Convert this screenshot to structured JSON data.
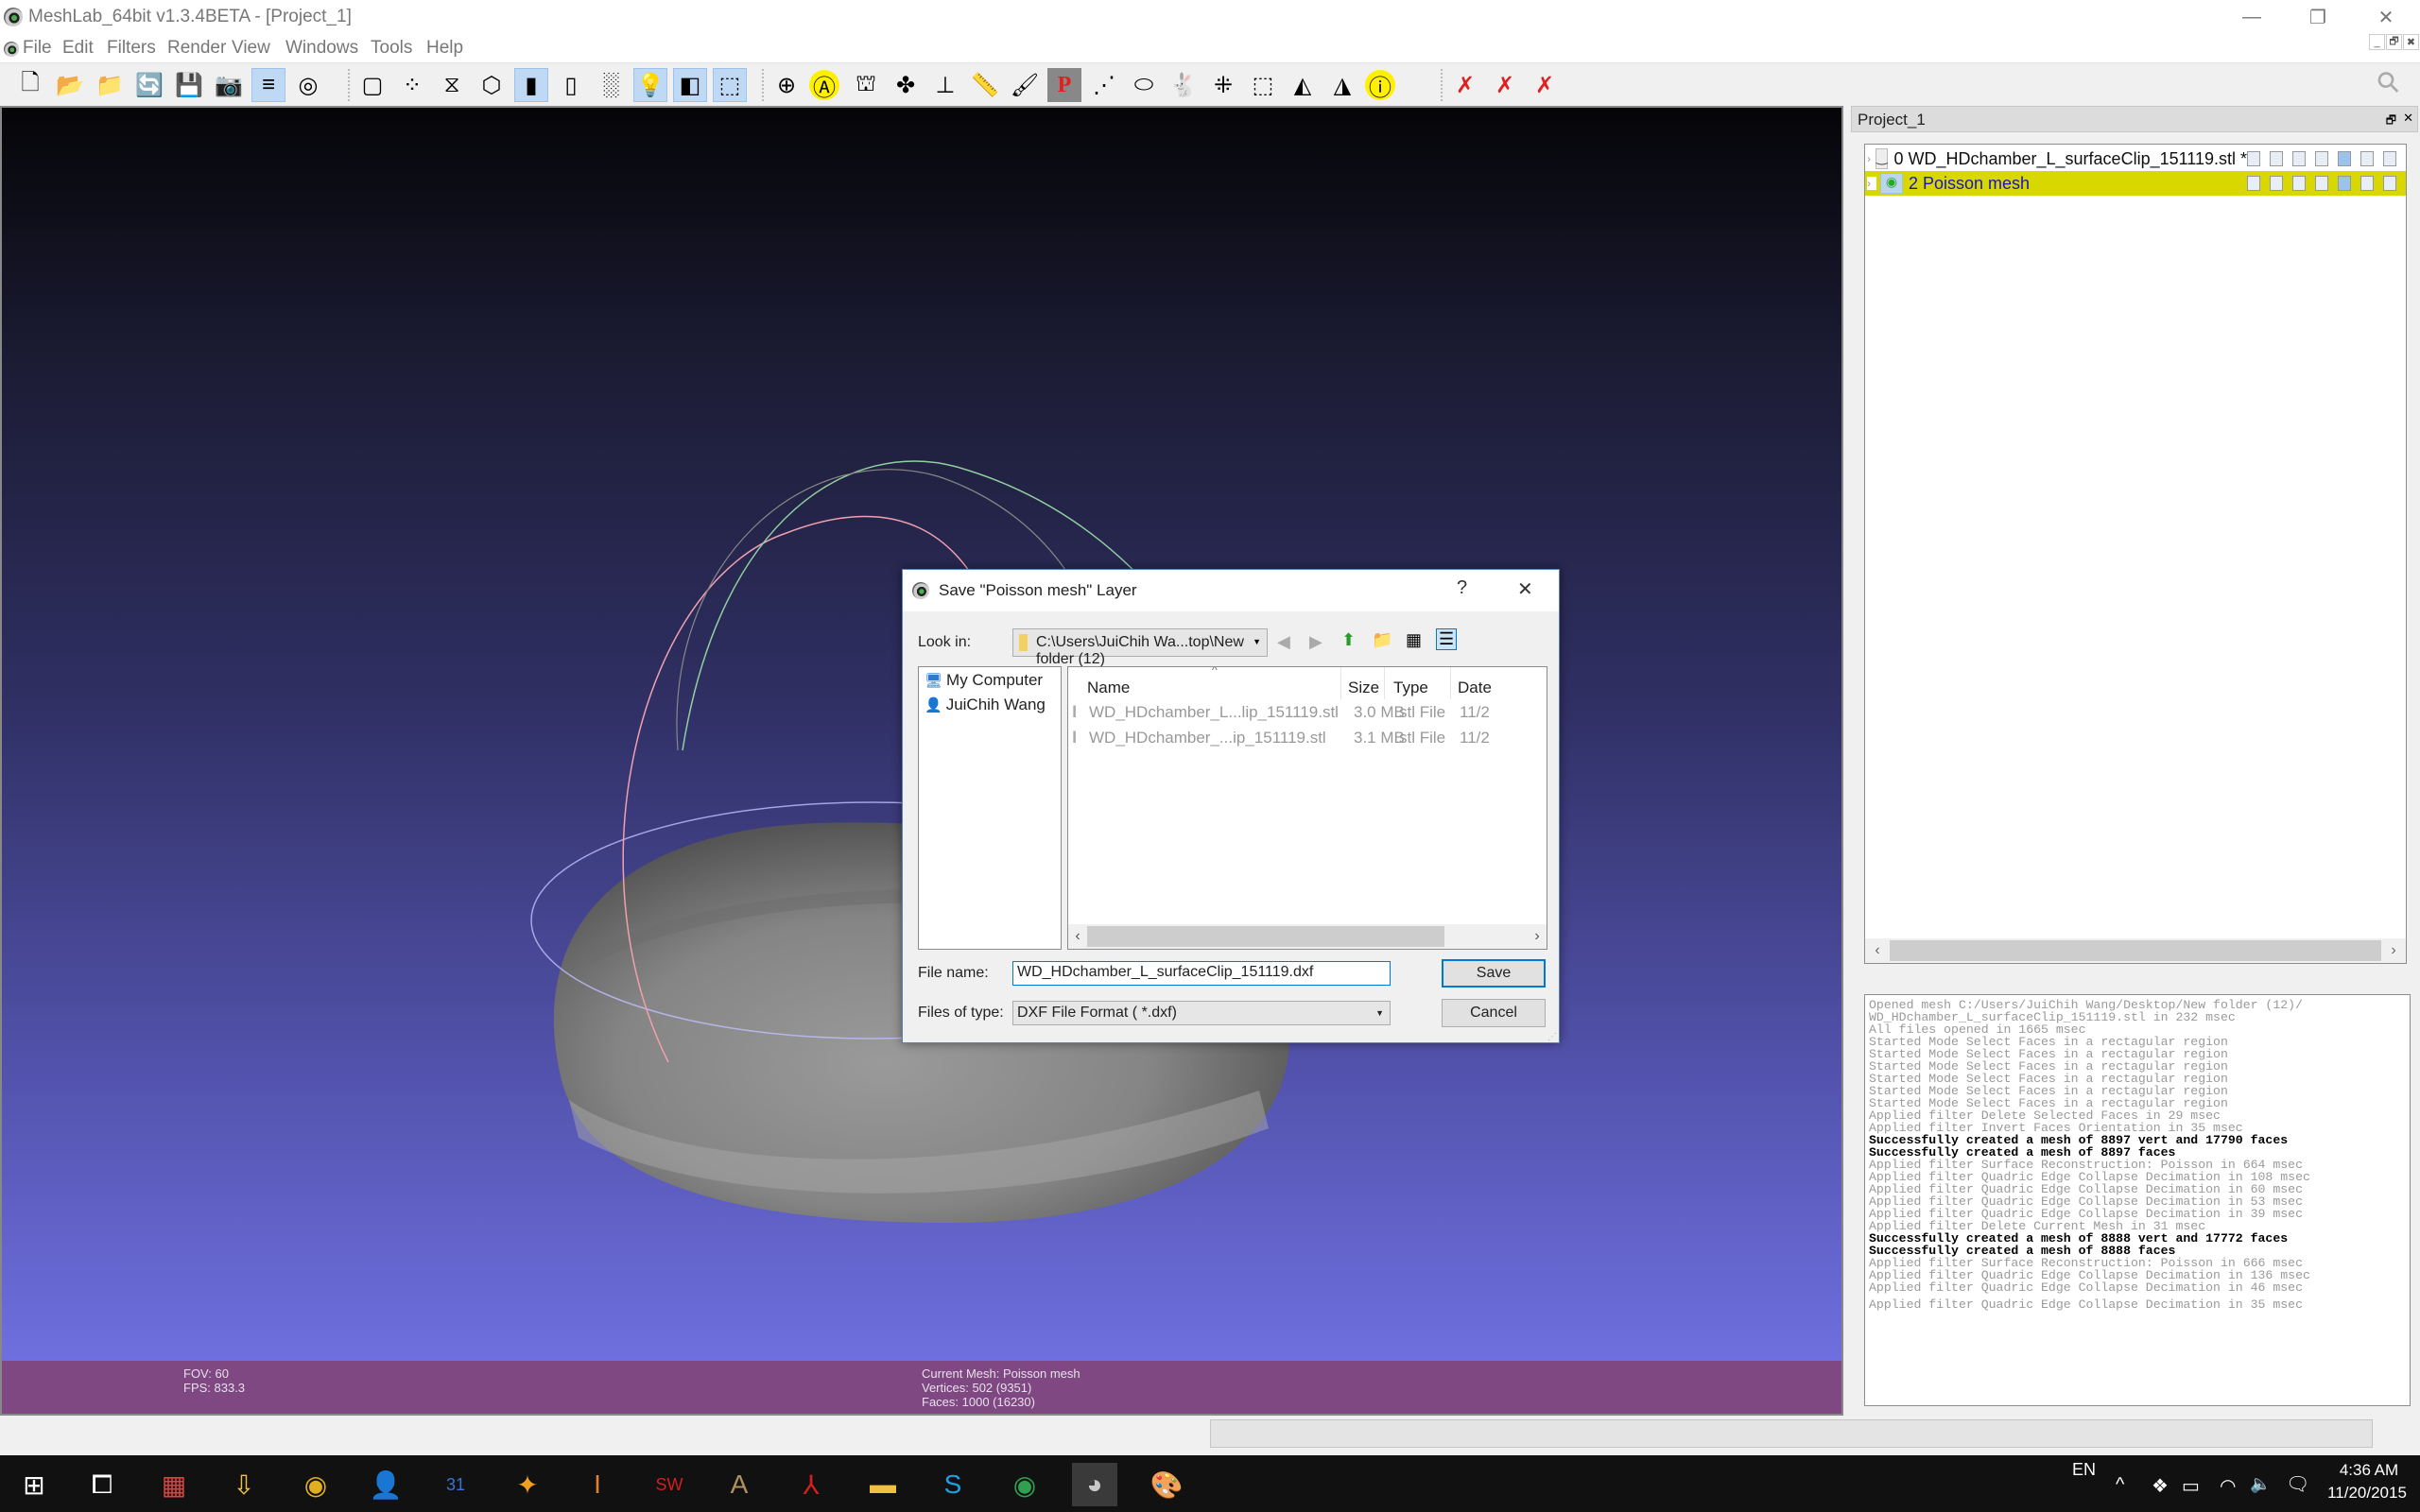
{
  "window": {
    "title": "MeshLab_64bit v1.3.4BETA - [Project_1]",
    "controls": {
      "minimize": "—",
      "restore": "❐",
      "close": "✕"
    },
    "mdi_controls": {
      "minimize": "_",
      "restore": "🗗",
      "close": "✖"
    }
  },
  "menu": [
    "File",
    "Edit",
    "Filters",
    "Render",
    "View",
    "Windows",
    "Tools",
    "Help"
  ],
  "toolbar": {
    "groups": [
      [
        {
          "name": "new-project-icon",
          "glyph": "🗋",
          "active": false
        },
        {
          "name": "open-mesh-icon",
          "glyph": "📂",
          "active": false
        },
        {
          "name": "reload-icon",
          "glyph": "📁",
          "active": false
        },
        {
          "name": "reload-all-icon",
          "glyph": "🔄",
          "active": false
        },
        {
          "name": "save-icon",
          "glyph": "💾",
          "active": false
        },
        {
          "name": "snapshot-icon",
          "glyph": "📷",
          "active": false
        },
        {
          "name": "layers-icon",
          "glyph": "≡",
          "active": true
        },
        {
          "name": "raster-icon",
          "glyph": "◎",
          "active": false
        }
      ],
      [
        {
          "name": "bbox-icon",
          "glyph": "▢",
          "active": false
        },
        {
          "name": "points-icon",
          "glyph": "⁘",
          "active": false
        },
        {
          "name": "wireframe-icon",
          "glyph": "⧖",
          "active": false
        },
        {
          "name": "flat-lines-icon",
          "glyph": "⬡",
          "active": false
        },
        {
          "name": "flat-icon",
          "glyph": "▮",
          "active": true
        },
        {
          "name": "smooth-icon",
          "glyph": "▯",
          "active": false
        },
        {
          "name": "texture-icon",
          "glyph": "░",
          "active": false
        },
        {
          "name": "light-icon",
          "glyph": "💡",
          "active": true
        },
        {
          "name": "backface-icon",
          "glyph": "◧",
          "active": true
        },
        {
          "name": "selected-vertices-icon",
          "glyph": "⬚",
          "active": true
        }
      ],
      [
        {
          "name": "trackball-icon",
          "glyph": "⊕",
          "active": false
        },
        {
          "name": "annotation-icon",
          "glyph": "Ⓐ",
          "active": false
        },
        {
          "name": "arc-icon",
          "glyph": "⛫",
          "active": false
        },
        {
          "name": "align-icon",
          "glyph": "✤",
          "active": false
        },
        {
          "name": "axis-icon",
          "glyph": "⊥",
          "active": false
        },
        {
          "name": "measure-icon",
          "glyph": "📏",
          "active": false
        },
        {
          "name": "paint-icon",
          "glyph": "🖌",
          "active": false
        },
        {
          "name": "pick-points-icon",
          "glyph": "P",
          "active": false
        },
        {
          "name": "select-connected-icon",
          "glyph": "⋰",
          "active": false
        },
        {
          "name": "select-vertices-icon",
          "glyph": "⬭",
          "active": false
        },
        {
          "name": "quality-map-icon",
          "glyph": "🐇",
          "active": false
        },
        {
          "name": "reference-icon",
          "glyph": "⁜",
          "active": false
        },
        {
          "name": "select-region-icon",
          "glyph": "⬚",
          "active": false
        },
        {
          "name": "select-faces-icon",
          "glyph": "◭",
          "active": false
        },
        {
          "name": "select-faces-add-icon",
          "glyph": "◮",
          "active": false
        },
        {
          "name": "info-icon",
          "glyph": "ⓘ",
          "active": false
        }
      ],
      [
        {
          "name": "delete-vertices-icon",
          "glyph": "✗",
          "active": false
        },
        {
          "name": "delete-faces-icon",
          "glyph": "✗",
          "active": false
        },
        {
          "name": "delete-faces-vertices-icon",
          "glyph": "✗",
          "active": false
        }
      ]
    ],
    "search_icon": "⚲"
  },
  "viewport": {
    "fov": "FOV: 60",
    "fps": "FPS:  833.3",
    "current_mesh": "Current Mesh: Poisson mesh",
    "vertices": "Vertices: 502 (9351)",
    "faces": "Faces: 1000 (16230)"
  },
  "layer_panel": {
    "title": "Project_1",
    "float_icon": "🗗",
    "close_icon": "✕",
    "layers": [
      {
        "label": "0 WD_HDchamber_L_surfaceClip_151119.stl *",
        "selected": false,
        "visible": false
      },
      {
        "label": "2 Poisson mesh",
        "selected": true,
        "visible": true
      }
    ]
  },
  "log": [
    {
      "text": "Opened mesh C:/Users/JuiChih Wang/Desktop/New folder (12)/",
      "bold": false
    },
    {
      "text": "WD_HDchamber_L_surfaceClip_151119.stl in 232 msec",
      "bold": false
    },
    {
      "text": "All files opened in 1665 msec",
      "bold": false
    },
    {
      "text": "Started Mode Select Faces in a rectagular region",
      "bold": false
    },
    {
      "text": "Started Mode Select Faces in a rectagular region",
      "bold": false
    },
    {
      "text": "Started Mode Select Faces in a rectagular region",
      "bold": false
    },
    {
      "text": "Started Mode Select Faces in a rectagular region",
      "bold": false
    },
    {
      "text": "Started Mode Select Faces in a rectagular region",
      "bold": false
    },
    {
      "text": "Started Mode Select Faces in a rectagular region",
      "bold": false
    },
    {
      "text": "Applied filter Delete Selected Faces in 29 msec",
      "bold": false
    },
    {
      "text": "Applied filter Invert Faces Orientation in 35 msec",
      "bold": false
    },
    {
      "text": "Successfully created a mesh of 8897 vert and 17790 faces",
      "bold": true
    },
    {
      "text": "Successfully created a mesh of 8897 faces",
      "bold": true
    },
    {
      "text": "Applied filter Surface Reconstruction: Poisson in 664 msec",
      "bold": false
    },
    {
      "text": "Applied filter Quadric Edge Collapse Decimation in 108 msec",
      "bold": false
    },
    {
      "text": "Applied filter Quadric Edge Collapse Decimation in 60 msec",
      "bold": false
    },
    {
      "text": "Applied filter Quadric Edge Collapse Decimation in 53 msec",
      "bold": false
    },
    {
      "text": "Applied filter Quadric Edge Collapse Decimation in 39 msec",
      "bold": false
    },
    {
      "text": "Applied filter Delete Current Mesh in 31 msec",
      "bold": false
    },
    {
      "text": "Successfully created a mesh of 8888 vert and 17772 faces",
      "bold": true
    },
    {
      "text": "Successfully created a mesh of 8888 faces",
      "bold": true
    },
    {
      "text": "Applied filter Surface Reconstruction: Poisson in 666 msec",
      "bold": false
    },
    {
      "text": "Applied filter Quadric Edge Collapse Decimation in 136 msec",
      "bold": false
    },
    {
      "text": "Applied filter Quadric Edge Collapse Decimation in 46 msec",
      "bold": false
    },
    {
      "text": "",
      "bold": false
    },
    {
      "text": "Applied filter Quadric Edge Collapse Decimation in 35 msec",
      "bold": false
    }
  ],
  "dialog": {
    "title": "Save \"Poisson mesh\" Layer",
    "help": "?",
    "close": "✕",
    "look_in_label": "Look in:",
    "look_in_value": "C:\\Users\\JuiChih Wa...top\\New folder (12)",
    "nav": {
      "back": "◀",
      "forward": "▶",
      "up": "⬆",
      "new_folder": "📁",
      "list_view": "▦",
      "detail_view": "☰"
    },
    "places": [
      {
        "label": "My Computer",
        "icon": "computer-icon"
      },
      {
        "label": "JuiChih Wang",
        "icon": "user-folder-icon"
      }
    ],
    "columns": [
      "Name",
      "Size",
      "Type",
      "Date"
    ],
    "sort_indicator": "^",
    "files": [
      {
        "name": "WD_HDchamber_L...lip_151119.stl",
        "size": "3.0 MB",
        "type": "stl File",
        "date": "11/2"
      },
      {
        "name": "WD_HDchamber_...ip_151119.stl",
        "size": "3.1 MB",
        "type": "stl File",
        "date": "11/2"
      }
    ],
    "file_name_label": "File name:",
    "file_name_value": "WD_HDchamber_L_surfaceClip_151119.dxf",
    "file_type_label": "Files of type:",
    "file_type_value": "DXF File Format ( *.dxf)",
    "save_label": "Save",
    "cancel_label": "Cancel"
  },
  "taskbar": {
    "apps": [
      {
        "name": "start-icon",
        "glyph": "⊞",
        "color": "#ffffff"
      },
      {
        "name": "task-view-icon",
        "glyph": "⧠",
        "color": "#ffffff"
      },
      {
        "name": "store-icon",
        "glyph": "▦",
        "color": "#e04040"
      },
      {
        "name": "downloads-icon",
        "glyph": "⇩",
        "color": "#f0c040"
      },
      {
        "name": "chrome-icon",
        "glyph": "◉",
        "color": "#e0b020"
      },
      {
        "name": "contacts-icon",
        "glyph": "👤",
        "color": "#2a8ad8"
      },
      {
        "name": "calendar-icon",
        "glyph": "31",
        "color": "#3b74d0"
      },
      {
        "name": "photos-icon",
        "glyph": "✦",
        "color": "#f0a020"
      },
      {
        "name": "inventor-icon",
        "glyph": "I",
        "color": "#e08030"
      },
      {
        "name": "solidworks-icon",
        "glyph": "SW",
        "color": "#d02020"
      },
      {
        "name": "autocad-icon",
        "glyph": "A",
        "color": "#b09060"
      },
      {
        "name": "acrobat-icon",
        "glyph": "⅄",
        "color": "#d02020"
      },
      {
        "name": "file-explorer-icon",
        "glyph": "▬",
        "color": "#f0c040"
      },
      {
        "name": "skype-icon",
        "glyph": "S",
        "color": "#1ea0e0"
      },
      {
        "name": "chrome-profile-icon",
        "glyph": "◉",
        "color": "#30a050"
      },
      {
        "name": "meshlab-icon",
        "glyph": "◕",
        "color": "#c8c8c8",
        "active": true
      },
      {
        "name": "paint-icon",
        "glyph": "🎨",
        "color": "#70b0e0"
      }
    ],
    "language": "EN",
    "tray": {
      "chevron": "^",
      "dropbox": "❖",
      "battery": "▭",
      "wifi": "◠",
      "volume": "🔈",
      "notifications": "🗨"
    },
    "time": "4:36 AM",
    "date": "11/20/2015"
  }
}
